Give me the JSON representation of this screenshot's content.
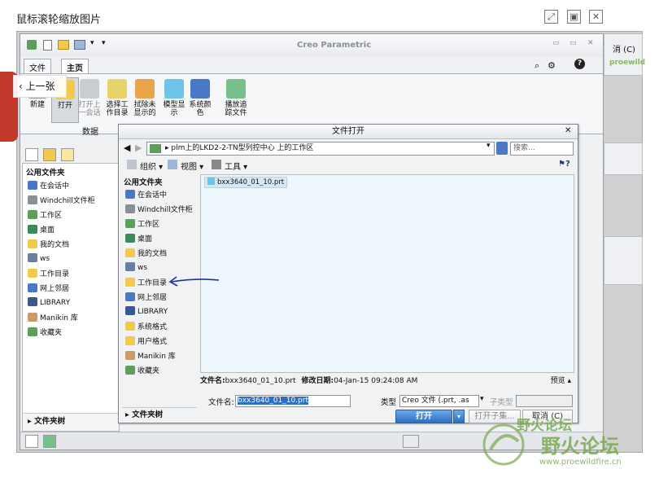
{
  "viewer": {
    "title": "鼠标滚轮缩放图片",
    "prev_label": "上一张",
    "fullscreen_glyph": "⤢",
    "restore_glyph": "▣",
    "close_glyph": "✕"
  },
  "app": {
    "title": "Creo Parametric",
    "menu_file": "文件",
    "tab_home": "主页",
    "window_min": "▭",
    "window_max": "▭",
    "window_close": "✕",
    "qat_arrow": "▾",
    "help": "?",
    "ribbon": {
      "buttons": [
        {
          "label": "新建",
          "color": "#ffffff"
        },
        {
          "label": "打开",
          "color": "#f2c94c"
        },
        {
          "label": "打开上一会话",
          "color": "#c9cdd2"
        },
        {
          "label": "选择工作目录",
          "color": "#e8d36a"
        },
        {
          "label": "拭除未显示的",
          "color": "#e8a54a"
        },
        {
          "label": "模型显示",
          "color": "#6ec4e8"
        },
        {
          "label": "系统颜色",
          "color": "#4a78c8"
        },
        {
          "label": "播放追踪文件",
          "color": "#78c08a"
        }
      ],
      "group_label": "数据"
    },
    "navigator": {
      "header": "公用文件夹",
      "items": [
        "在会话中",
        "Windchill文件柜",
        "工作区",
        "桌面",
        "我的文档",
        "ws",
        "工作目录",
        "网上邻居",
        "LIBRARY",
        "Manikin 库",
        "收藏夹"
      ],
      "footer": "文件夹树"
    }
  },
  "dialog": {
    "title": "文件打开",
    "close": "✕",
    "address": "plm上的LKD2-2-TN型列控中心 上的工作区",
    "search_placeholder": "搜索...",
    "toolbar": {
      "organize": "组织",
      "views": "视图",
      "tools": "工具"
    },
    "nav_header": "公用文件夹",
    "nav_items": [
      "在会话中",
      "Windchill文件柜",
      "工作区",
      "桌面",
      "我的文档",
      "ws",
      "工作目录",
      "网上邻居",
      "LIBRARY",
      "系统格式",
      "用户格式",
      "Manikin 库",
      "收藏夹"
    ],
    "nav_footer": "文件夹树",
    "file_item": "bxx3640_01_10.prt",
    "info": {
      "name_label": "文件名:",
      "name_value": "bxx3640_01_10.prt",
      "date_label": "修改日期:",
      "date_value": "04-Jan-15 09:24:08 AM",
      "preview": "预览"
    },
    "filename_label": "文件名:",
    "filename_value": "bxx3640_01_10.prt",
    "type_label": "类型",
    "type_value": "Creo 文件 (.prt, .as",
    "subtype_label": "子类型",
    "open_button": "打开",
    "open_sub_button": "打开子集...",
    "cancel_button": "取消 (C)"
  },
  "watermark": {
    "text_small": "野火论坛",
    "text_big": "野火论坛",
    "url": "www.proewildfire.cn",
    "url_top": "proewild"
  },
  "background_app": {
    "cancel_text": "消 (C)"
  }
}
